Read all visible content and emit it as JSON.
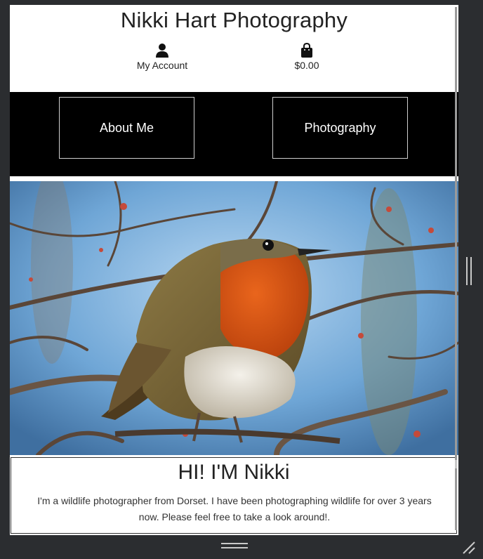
{
  "header": {
    "site_title": "Nikki Hart Photography",
    "account_label": "My Account",
    "account_icon": "user-icon",
    "cart_total": "$0.00",
    "cart_icon": "shopping-bag-icon"
  },
  "nav": {
    "items": [
      {
        "label": "About Me"
      },
      {
        "label": "Photography"
      }
    ]
  },
  "hero": {
    "subject": "robin-photo"
  },
  "intro": {
    "heading": "HI! I'M Nikki",
    "text": "I'm a wildlife photographer from Dorset. I have been photographing wildlife for over 3 years now. Please feel free to take a look around!."
  },
  "colors": {
    "nav_bg": "#000000",
    "page_bg": "#ffffff",
    "frame_bg": "#2b2d30"
  }
}
